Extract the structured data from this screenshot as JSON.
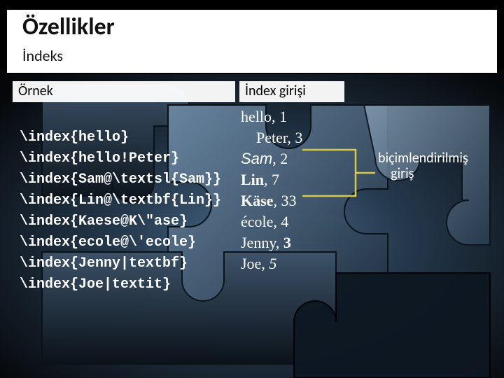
{
  "header": {
    "title": "Özellikler",
    "subtitle": "İndeks"
  },
  "columns": {
    "left_label": "Örnek",
    "right_label": "İndex girişi"
  },
  "code": {
    "lines": [
      "\\index{hello}",
      "\\index{hello!Peter}",
      "\\index{Sam@\\textsl{Sam}}",
      "\\index{Lin@\\textbf{Lin}}",
      "\\index{Kaese@K\\\"ase}",
      "\\index{ecole@\\'ecole}",
      "\\index{Jenny|textbf}",
      "\\index{Joe|textit}"
    ]
  },
  "output": {
    "rows": [
      {
        "text": "hello",
        "page": "1",
        "style": "plain",
        "indent": false
      },
      {
        "text": "Peter",
        "page": "3",
        "style": "plain",
        "indent": true
      },
      {
        "text": "Sam",
        "page": "2",
        "style": "slanted",
        "indent": false
      },
      {
        "text": "Lin",
        "page": "7",
        "style": "bold",
        "indent": false
      },
      {
        "text": "Käse",
        "page": "33",
        "style": "bold",
        "indent": false
      },
      {
        "text": "école",
        "page": "4",
        "style": "plain",
        "indent": false
      },
      {
        "text": "Jenny",
        "page": "3",
        "style": "plain",
        "page_style": "bold",
        "indent": false
      },
      {
        "text": "Joe",
        "page": "5",
        "style": "plain",
        "page_style": "italic",
        "indent": false
      }
    ]
  },
  "annotation": {
    "line1": "biçimlendirilmiş",
    "line2": "giriş"
  },
  "colors": {
    "bracket": "#d9c94a"
  }
}
